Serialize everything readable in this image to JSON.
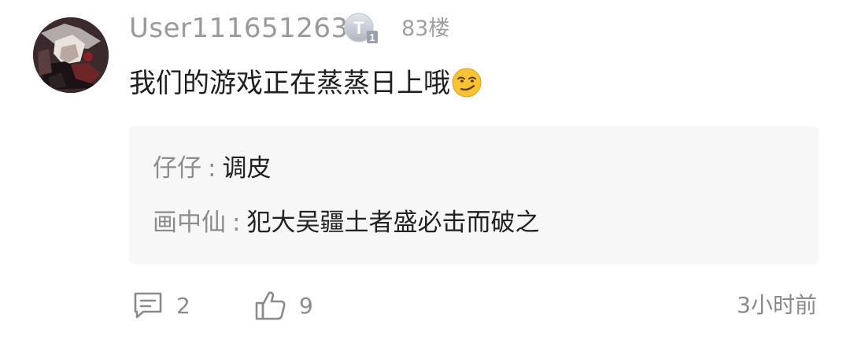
{
  "comment": {
    "username": "User111651263",
    "level_badge": "T",
    "level_number": "1",
    "floor": "83楼",
    "text": "我们的游戏正在蒸蒸日上哦",
    "emoji_icon": "smirk-emoji-icon"
  },
  "replies": [
    {
      "author": "仔仔",
      "colon": ":",
      "content": "调皮"
    },
    {
      "author": "画中仙",
      "colon": ":",
      "content": "犯大吴疆土者盛必击而破之"
    }
  ],
  "actions": {
    "comment_count": "2",
    "like_count": "9",
    "timestamp": "3小时前"
  },
  "colors": {
    "username": "#9a9a9a",
    "reply_box": "#f7f7f7",
    "muted": "#8a8a8a",
    "text": "#1f1f1f"
  }
}
